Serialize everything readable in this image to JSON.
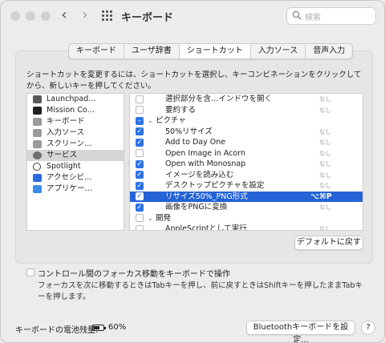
{
  "window": {
    "title": "キーボード"
  },
  "toolbar": {
    "back": "‹",
    "forward": "›"
  },
  "search": {
    "placeholder": "検索"
  },
  "tabs": [
    {
      "label": "キーボード"
    },
    {
      "label": "ユーザ辞書"
    },
    {
      "label": "ショートカット",
      "active": true
    },
    {
      "label": "入力ソース"
    },
    {
      "label": "音声入力"
    }
  ],
  "description": "ショートカットを変更するには、ショートカットを選択し、キーコンビネーションをクリックしてから、新しいキーを押してください。",
  "categories": [
    {
      "label": "Launchpad…",
      "icon": "launchpad-icon",
      "color": "#5a5a5a"
    },
    {
      "label": "Mission Co…",
      "icon": "mission-control-icon",
      "color": "#1f1f1f"
    },
    {
      "label": "キーボード",
      "icon": "keyboard-icon",
      "color": "#9a9a9a"
    },
    {
      "label": "入力ソース",
      "icon": "input-sources-icon",
      "color": "#9a9a9a"
    },
    {
      "label": "スクリーン…",
      "icon": "screenshot-icon",
      "color": "#9a9a9a"
    },
    {
      "label": "サービス",
      "icon": "services-gear-icon",
      "color": "#6e6e6e",
      "selected": true
    },
    {
      "label": "Spotlight",
      "icon": "spotlight-icon",
      "color": "#3b3b3b"
    },
    {
      "label": "アクセシビ…",
      "icon": "accessibility-icon",
      "color": "#2a6be0"
    },
    {
      "label": "アプリケー…",
      "icon": "app-shortcuts-icon",
      "color": "#3a8ae8"
    }
  ],
  "shortcuts": [
    {
      "type": "item",
      "checked": false,
      "name": "選択部分を含…インドウを開く",
      "key": "なし"
    },
    {
      "type": "item",
      "checked": false,
      "name": "要約する",
      "key": "なし"
    },
    {
      "type": "group",
      "checked": "mixed",
      "name": "ピクチャ",
      "key": ""
    },
    {
      "type": "item",
      "checked": true,
      "name": "50%リサイズ",
      "key": "なし"
    },
    {
      "type": "item",
      "checked": true,
      "name": "Add to Day One",
      "key": "なし"
    },
    {
      "type": "item",
      "checked": false,
      "name": "Open Image in Acorn",
      "key": "なし"
    },
    {
      "type": "item",
      "checked": true,
      "name": "Open with Monosnap",
      "key": "なし"
    },
    {
      "type": "item",
      "checked": true,
      "name": "イメージを読み込む",
      "key": "なし"
    },
    {
      "type": "item",
      "checked": true,
      "name": "デスクトップピクチャを設定",
      "key": "なし"
    },
    {
      "type": "item",
      "checked": true,
      "name": "リサイズ50%_PNG形式",
      "key": "⌥⌘P",
      "selected": true
    },
    {
      "type": "item",
      "checked": true,
      "name": "画像をPNGに変換",
      "key": "なし"
    },
    {
      "type": "group",
      "checked": false,
      "name": "開発",
      "key": ""
    },
    {
      "type": "item",
      "checked": false,
      "name": "AppleScriptとして実行",
      "key": "なし"
    }
  ],
  "buttons": {
    "restore_defaults": "デフォルトに戻す",
    "bluetooth": "Bluetoothキーボードを設定...",
    "help": "?"
  },
  "focus": {
    "checkbox_label": "コントロール間のフォーカス移動をキーボードで操作",
    "hint": "フォーカスを次に移動するときはTabキーを押し、前に戻すときはShiftキーを押したままTabキーを押します。",
    "checked": false
  },
  "battery": {
    "label": "キーボードの電池残量:",
    "value": "60%",
    "level": 0.6
  }
}
